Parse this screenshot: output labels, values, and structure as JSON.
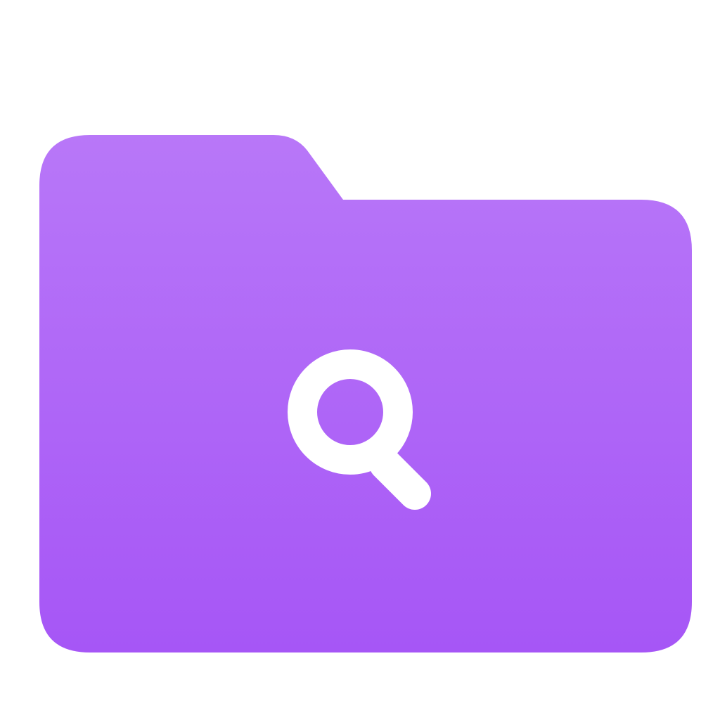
{
  "icon": {
    "type": "folder",
    "glyph": "magnifying-glass-icon",
    "colors": {
      "folder_top": "#b877f8",
      "folder_bottom": "#a656f6",
      "glyph": "#ffffff",
      "background": "#ffffff"
    }
  }
}
